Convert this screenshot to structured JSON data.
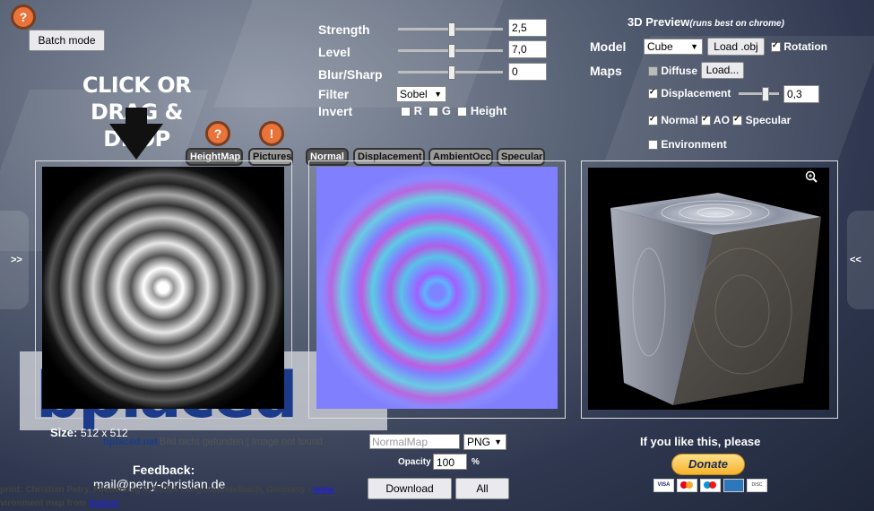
{
  "header": {
    "help_icon": "question-icon",
    "batch_mode": "Batch mode"
  },
  "controls": {
    "strength_label": "Strength",
    "strength_value": "2,5",
    "level_label": "Level",
    "level_value": "7,0",
    "blur_label": "Blur/Sharp",
    "blur_value": "0",
    "filter_label": "Filter",
    "filter_value": "Sobel",
    "invert_label": "Invert",
    "invert_r": "R",
    "invert_g": "G",
    "invert_height": "Height"
  },
  "preview3d": {
    "title": "3D Preview",
    "subtitle": "(runs best on chrome)",
    "model_label": "Model",
    "model_value": "Cube",
    "load_obj": "Load .obj",
    "rotation": "Rotation",
    "maps_label": "Maps",
    "diffuse": "Diffuse",
    "load_btn": "Load...",
    "displacement": "Displacement",
    "displacement_value": "0,3",
    "normal": "Normal",
    "ao": "AO",
    "specular": "Specular",
    "environment": "Environment",
    "zoom_icon": "zoom-icon"
  },
  "left_panel": {
    "drop_text_1": "CLICK OR",
    "drop_text_2": "DRAG & DROP",
    "tab_heightmap": "HeightMap",
    "tab_pictures": "Pictures",
    "size_label": "Size:",
    "size_value": "512 x 512",
    "bplaced_text": "bplaced",
    "bplaced_note": "bplaced.net",
    "image_not_found": "Bild nicht gefunden | Image not found"
  },
  "middle_panel": {
    "tab_normal": "Normal",
    "tab_displacement": "Displacement",
    "tab_ambient": "AmbientOcc",
    "tab_specular": "Specular",
    "filename_placeholder": "NormalMap",
    "format_value": "PNG",
    "opacity_label": "Opacity",
    "opacity_value": "100",
    "opacity_unit": "%",
    "download": "Download",
    "all": "All"
  },
  "side_arrows": {
    "left": ">>",
    "right": "<<"
  },
  "feedback": {
    "label": "Feedback:",
    "email": "mail@petry-christian.de"
  },
  "footer": {
    "imprint": "print: Christian Petry, Fliederweg 8, 91054 Langensendelbach, Germany - ",
    "imprint_link": "www",
    "env": "vironment map from ",
    "env_link": "humus"
  },
  "donate": {
    "text": "If you like this, please",
    "button": "Donate"
  },
  "colors": {
    "accent": "#e8743b",
    "donate": "#f7c23c",
    "normal_map": "#8080ff"
  }
}
